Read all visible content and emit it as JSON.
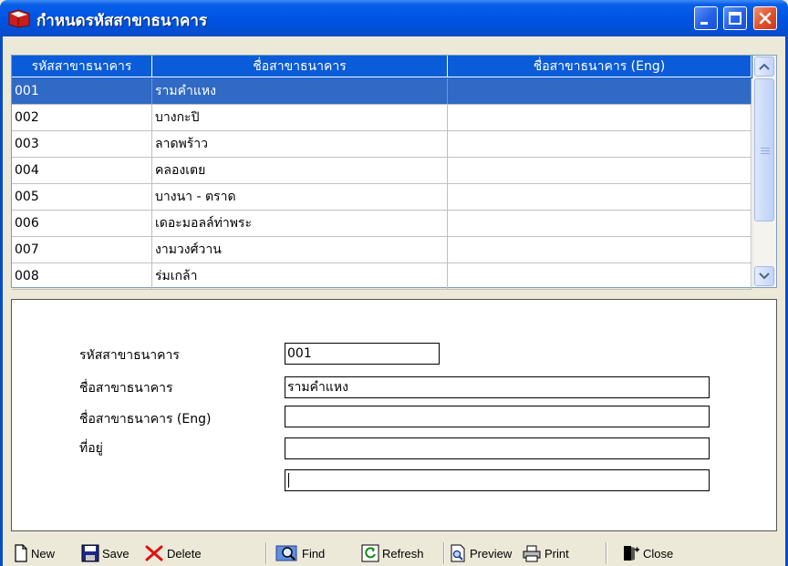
{
  "window": {
    "title": "กำหนดรหัสสาขาธนาคาร",
    "icon": "book-icon"
  },
  "grid": {
    "columns": [
      "รหัสสาขาธนาคาร",
      "ชื่อสาขาธนาคาร",
      "ชื่อสาขาธนาคาร (Eng)"
    ],
    "rows": [
      {
        "code": "001",
        "name": "รามคำแหง",
        "name_eng": ""
      },
      {
        "code": "002",
        "name": "บางกะปิ",
        "name_eng": ""
      },
      {
        "code": "003",
        "name": "ลาดพร้าว",
        "name_eng": ""
      },
      {
        "code": "004",
        "name": "คลองเตย",
        "name_eng": ""
      },
      {
        "code": "005",
        "name": "บางนา - ตราด",
        "name_eng": ""
      },
      {
        "code": "006",
        "name": "เดอะมอลล์ท่าพระ",
        "name_eng": ""
      },
      {
        "code": "007",
        "name": "งามวงศ์วาน",
        "name_eng": ""
      },
      {
        "code": "008",
        "name": "ร่มเกล้า",
        "name_eng": ""
      }
    ],
    "selected_index": 0
  },
  "form": {
    "code_label": "รหัสสาขาธนาคาร",
    "code_value": "001",
    "name_label": "ชื่อสาขาธนาคาร",
    "name_value": "รามคำแหง",
    "name_eng_label": "ชื่อสาขาธนาคาร (Eng)",
    "name_eng_value": "",
    "address_label": "ที่อยู่",
    "address_line1_value": "",
    "address_line2_value": ""
  },
  "toolbar": {
    "new": "New",
    "save": "Save",
    "delete": "Delete",
    "find": "Find",
    "refresh": "Refresh",
    "preview": "Preview",
    "print": "Print",
    "close": "Close"
  },
  "colors": {
    "titlebar": "#0055E5",
    "selection": "#316AC5",
    "header": "#0A5CD8",
    "window_bg": "#ECE9D8"
  }
}
